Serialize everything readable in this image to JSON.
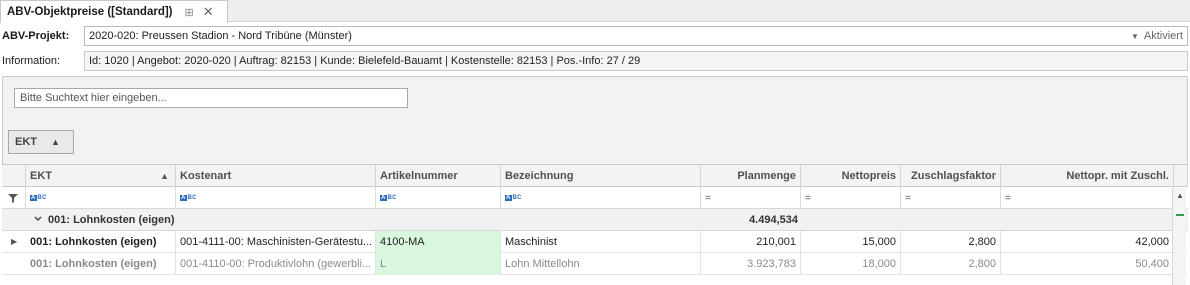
{
  "tab": {
    "title": "ABV-Objektpreise ([Standard])",
    "pin_icon": "pin-icon",
    "close_icon": "close-icon"
  },
  "project": {
    "label": "ABV-Projekt:",
    "value": "2020-020: Preussen Stadion - Nord Tribüne (Münster)",
    "status": "Aktiviert"
  },
  "information": {
    "label": "Information:",
    "value": "Id: 1020 | Angebot: 2020-020 | Auftrag: 82153 | Kunde: Bielefeld-Bauamt | Kostenstelle: 82153 | Pos.-Info: 27 / 29"
  },
  "search": {
    "placeholder": "Bitte Suchtext hier eingeben..."
  },
  "group_panel": {
    "chip_label": "EKT"
  },
  "grid": {
    "columns": [
      "EKT",
      "Kostenart",
      "Artikelnummer",
      "Bezeichnung",
      "Planmenge",
      "Nettopreis",
      "Zuschlagsfaktor",
      "Nettopr. mit Zuschl."
    ],
    "filter_operator": "=",
    "group": {
      "title": "001: Lohnkosten (eigen)",
      "sum": "4.494,534"
    },
    "rows": [
      {
        "ekt": "001: Lohnkosten (eigen)",
        "kostenart": "001-4111-00: Maschinisten-Gerätestu...",
        "artikelnummer": "4100-MA",
        "bezeichnung": "Maschinist",
        "planmenge": "210,001",
        "nettopreis": "15,000",
        "zuschlagsfaktor": "2,800",
        "nettopreis_zuschl": "42,000"
      },
      {
        "ekt": "001: Lohnkosten (eigen)",
        "kostenart": "001-4110-00: Produktivlohn (gewerbli...",
        "artikelnummer": "L",
        "bezeichnung": "Lohn Mittellohn",
        "planmenge": "3.923,783",
        "nettopreis": "18,000",
        "zuschlagsfaktor": "2,800",
        "nettopreis_zuschl": "50,400"
      }
    ]
  }
}
